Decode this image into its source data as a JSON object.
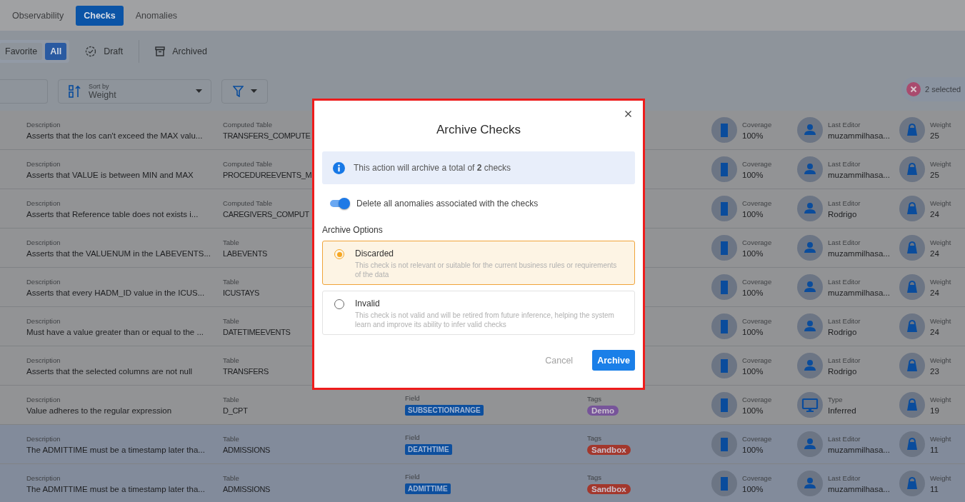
{
  "tabs": [
    {
      "label": "Observability",
      "selected": false
    },
    {
      "label": "Checks",
      "selected": true
    },
    {
      "label": "Anomalies",
      "selected": false
    }
  ],
  "status_filter": {
    "segments": [
      {
        "label": "Favorite",
        "selected": false
      },
      {
        "label": "All",
        "selected": true
      }
    ],
    "views": [
      {
        "label": "Draft",
        "kind": "draft"
      },
      {
        "label": "Archived",
        "kind": "archived"
      }
    ]
  },
  "toolbar": {
    "sort": {
      "label": "Sort by",
      "value": "Weight"
    },
    "selection": {
      "count_label": "2 selected"
    }
  },
  "rows": [
    {
      "kind": "user",
      "description_label": "Description",
      "description": "Asserts that the los can't exceed the MAX valu...",
      "table_label": "Computed Table",
      "table": "TRANSFERS_COMPUTE",
      "coverage_label": "Coverage",
      "coverage": "100%",
      "editor_label": "Last Editor",
      "editor": "muzammilhasa...",
      "weight_label": "Weight",
      "weight": "25",
      "selected": false
    },
    {
      "kind": "user",
      "description_label": "Description",
      "description": "Asserts that VALUE is between MIN and MAX",
      "table_label": "Computed Table",
      "table": "PROCEDUREEVENTS_M",
      "coverage_label": "Coverage",
      "coverage": "100%",
      "editor_label": "Last Editor",
      "editor": "muzammilhasa...",
      "weight_label": "Weight",
      "weight": "25",
      "selected": false
    },
    {
      "kind": "user",
      "description_label": "Description",
      "description": "Asserts that Reference table does not exists i...",
      "table_label": "Computed Table",
      "table": "CAREGIVERS_COMPUT",
      "coverage_label": "Coverage",
      "coverage": "100%",
      "editor_label": "Last Editor",
      "editor": "Rodrigo",
      "weight_label": "Weight",
      "weight": "24",
      "selected": false
    },
    {
      "kind": "user",
      "description_label": "Description",
      "description": "Asserts that the VALUENUM in the LABEVENTS...",
      "table_label": "Table",
      "table": "LABEVENTS",
      "coverage_label": "Coverage",
      "coverage": "100%",
      "editor_label": "Last Editor",
      "editor": "muzammilhasa...",
      "weight_label": "Weight",
      "weight": "24",
      "selected": false
    },
    {
      "kind": "user",
      "description_label": "Description",
      "description": "Asserts that every HADM_ID value in the ICUS...",
      "table_label": "Table",
      "table": "ICUSTAYS",
      "coverage_label": "Coverage",
      "coverage": "100%",
      "editor_label": "Last Editor",
      "editor": "muzammilhasa...",
      "weight_label": "Weight",
      "weight": "24",
      "selected": false
    },
    {
      "kind": "user",
      "description_label": "Description",
      "description": "Must have a value greater than or equal to the ...",
      "table_label": "Table",
      "table": "DATETIMEEVENTS",
      "coverage_label": "Coverage",
      "coverage": "100%",
      "editor_label": "Last Editor",
      "editor": "Rodrigo",
      "weight_label": "Weight",
      "weight": "24",
      "selected": false
    },
    {
      "kind": "user",
      "description_label": "Description",
      "description": "Asserts that the selected columns are not null",
      "table_label": "Table",
      "table": "TRANSFERS",
      "coverage_label": "Coverage",
      "coverage": "100%",
      "editor_label": "Last Editor",
      "editor": "Rodrigo",
      "weight_label": "Weight",
      "weight": "23",
      "selected": false
    },
    {
      "kind": "type",
      "description_label": "Description",
      "description": "Value adheres to the regular expression",
      "table_label": "Table",
      "table": "D_CPT",
      "field_label": "Field",
      "field": "SUBSECTIONRANGE",
      "tags_label": "Tags",
      "tags": [
        {
          "label": "Demo",
          "color": "#77549a"
        }
      ],
      "coverage_label": "Coverage",
      "coverage": "100%",
      "editor_label": "Type",
      "editor": "Inferred",
      "weight_label": "Weight",
      "weight": "19",
      "selected": false
    },
    {
      "kind": "user",
      "description_label": "Description",
      "description": "The ADMITTIME must be a timestamp later tha...",
      "table_label": "Table",
      "table": "ADMISSIONS",
      "field_label": "Field",
      "field": "DEATHTIME",
      "tags_label": "Tags",
      "tags": [
        {
          "label": "Sandbox",
          "color": "#a3372c"
        }
      ],
      "coverage_label": "Coverage",
      "coverage": "100%",
      "editor_label": "Last Editor",
      "editor": "muzammilhasa...",
      "weight_label": "Weight",
      "weight": "11",
      "selected": true
    },
    {
      "kind": "user",
      "description_label": "Description",
      "description": "The ADMITTIME must be a timestamp later tha...",
      "table_label": "Table",
      "table": "ADMISSIONS",
      "field_label": "Field",
      "field": "ADMITTIME",
      "tags_label": "Tags",
      "tags": [
        {
          "label": "Sandbox",
          "color": "#a3372c"
        }
      ],
      "coverage_label": "Coverage",
      "coverage": "100%",
      "editor_label": "Last Editor",
      "editor": "muzammilhasa...",
      "weight_label": "Weight",
      "weight": "11",
      "selected": true
    }
  ],
  "dialog": {
    "title": "Archive Checks",
    "info": "This action will archive a total of **2** checks",
    "toggle": {
      "label": "Delete all anomalies associated with the checks",
      "on": true
    },
    "options_title": "Archive Options",
    "options": [
      {
        "label": "Discarded",
        "description": "This check is not relevant or suitable for the current business rules or requirements of the data",
        "selected": true
      },
      {
        "label": "Invalid",
        "description": "This check is not valid and will be retired from future inference, helping the system learn and improve its ability to infer valid checks",
        "selected": false
      }
    ],
    "buttons": [
      {
        "label": "Cancel",
        "kind": "text"
      },
      {
        "label": "Archive",
        "kind": "primary"
      }
    ]
  }
}
